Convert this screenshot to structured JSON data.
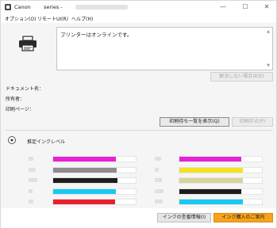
{
  "window": {
    "title_prefix": "Canon",
    "title_suffix": "series -",
    "minimize_glyph": "—",
    "maximize_glyph": "☐",
    "close_glyph": "✕"
  },
  "menu": {
    "items": [
      "オプション(O)",
      "リモートUI(R)",
      "ヘルプ(H)"
    ]
  },
  "status": {
    "message": "プリンターはオンラインです。",
    "troubleshoot_label": "解決しない場合は(E)"
  },
  "info": {
    "document_label": "ドキュメント名：",
    "owner_label": "所有者：",
    "pages_label": "印刷ページ："
  },
  "buttons": {
    "queue_label": "印刷待ち一覧を表示(Q)",
    "cancel_label": "印刷中止(P)",
    "ink_model_label": "インクの型番情報(I)",
    "ink_purchase_label": "インク購入のご案内"
  },
  "ink": {
    "title": "推定インクレベル",
    "left": [
      {
        "color": "#e821d6",
        "level": 0.76
      },
      {
        "color": "#8d8d8d",
        "level": 0.77
      },
      {
        "color": "#1c1c1c",
        "level": 0.78
      },
      {
        "color": "#19c8f0",
        "level": 0.76
      },
      {
        "color": "#e8202e",
        "level": 0.75
      }
    ],
    "right": [
      {
        "color": "#e821d6",
        "level": 0.75
      },
      {
        "color": "#f5e11c",
        "level": 0.77
      },
      {
        "color": "#d8d39a",
        "level": 0.77
      },
      {
        "color": "#1c1c1c",
        "level": 0.75
      },
      {
        "color": "#19c8f0",
        "level": 0.77
      }
    ]
  }
}
